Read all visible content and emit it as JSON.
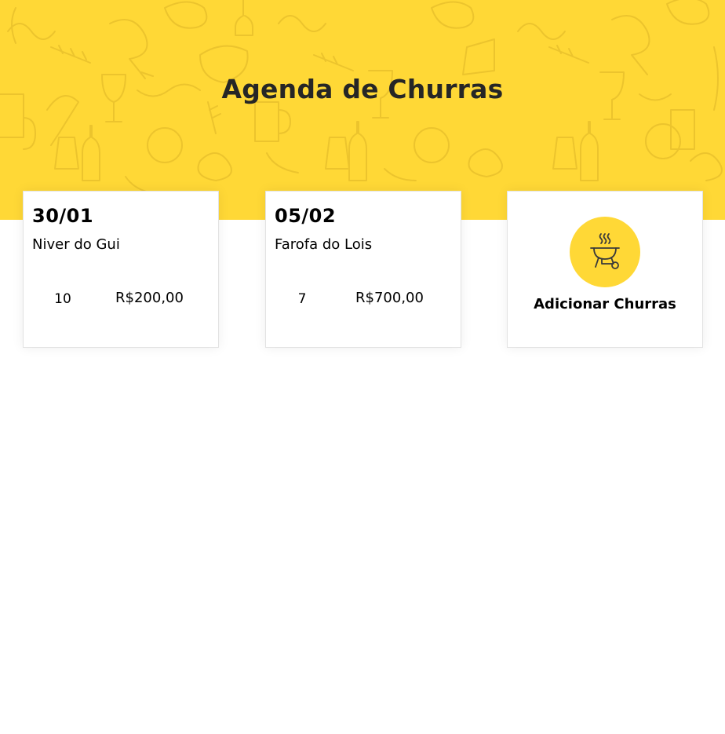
{
  "header": {
    "title": "Agenda de Churras",
    "background_color": "#FFD836"
  },
  "events": [
    {
      "date": "30/01",
      "title": "Niver do Gui",
      "people": "10",
      "total": "R$200,00"
    },
    {
      "date": "05/02",
      "title": "Farofa do Lois",
      "people": "7",
      "total": "R$700,00"
    }
  ],
  "add_card": {
    "label": "Adicionar Churras",
    "icon": "barbecue-grill-icon"
  }
}
